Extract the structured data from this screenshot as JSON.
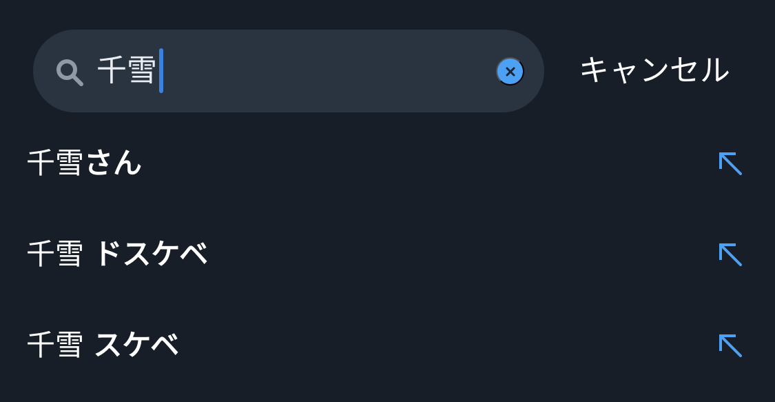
{
  "search": {
    "query": "千雪",
    "clear_icon": "close-circle-icon",
    "search_icon": "search-icon"
  },
  "cancel_label": "キャンセル",
  "suggestions": [
    {
      "term": "千雪",
      "completion": "さん",
      "arrow_icon": "fill-arrow-up-left-icon"
    },
    {
      "term": "千雪 ",
      "completion": "ドスケベ",
      "arrow_icon": "fill-arrow-up-left-icon"
    },
    {
      "term": "千雪 ",
      "completion": "スケベ",
      "arrow_icon": "fill-arrow-up-left-icon"
    }
  ],
  "colors": {
    "background": "#171e27",
    "search_pill": "#2a3441",
    "accent": "#4da1f5",
    "caret": "#3b82e0"
  }
}
